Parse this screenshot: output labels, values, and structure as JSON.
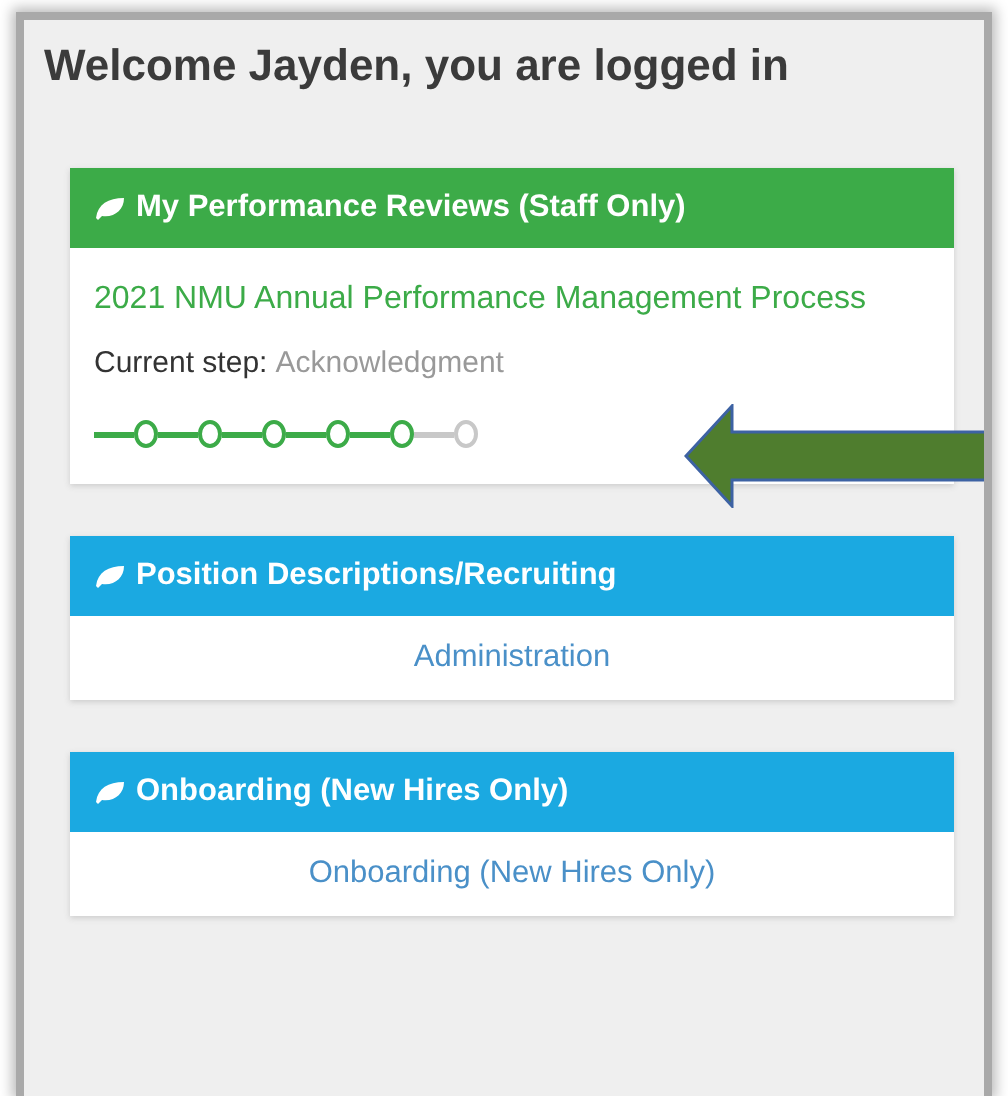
{
  "welcome": {
    "title": "Welcome Jayden, you are logged in"
  },
  "cards": [
    {
      "kind": "progress",
      "title": "My Performance Reviews (Staff Only)",
      "color": "#3cab48",
      "process": "2021 NMU Annual Performance Management Process",
      "step_label": "Current step:",
      "step_value": "Acknowledgment",
      "steps": [
        {
          "done": true
        },
        {
          "done": true
        },
        {
          "done": true
        },
        {
          "done": true
        },
        {
          "done": true
        },
        {
          "done": false
        }
      ]
    },
    {
      "kind": "link",
      "title": "Position Descriptions/Recruiting",
      "color": "#1ba9e1",
      "link": "Administration"
    },
    {
      "kind": "link",
      "title": "Onboarding (New Hires Only)",
      "color": "#1ba9e1",
      "link": "Onboarding (New Hires Only)"
    }
  ]
}
